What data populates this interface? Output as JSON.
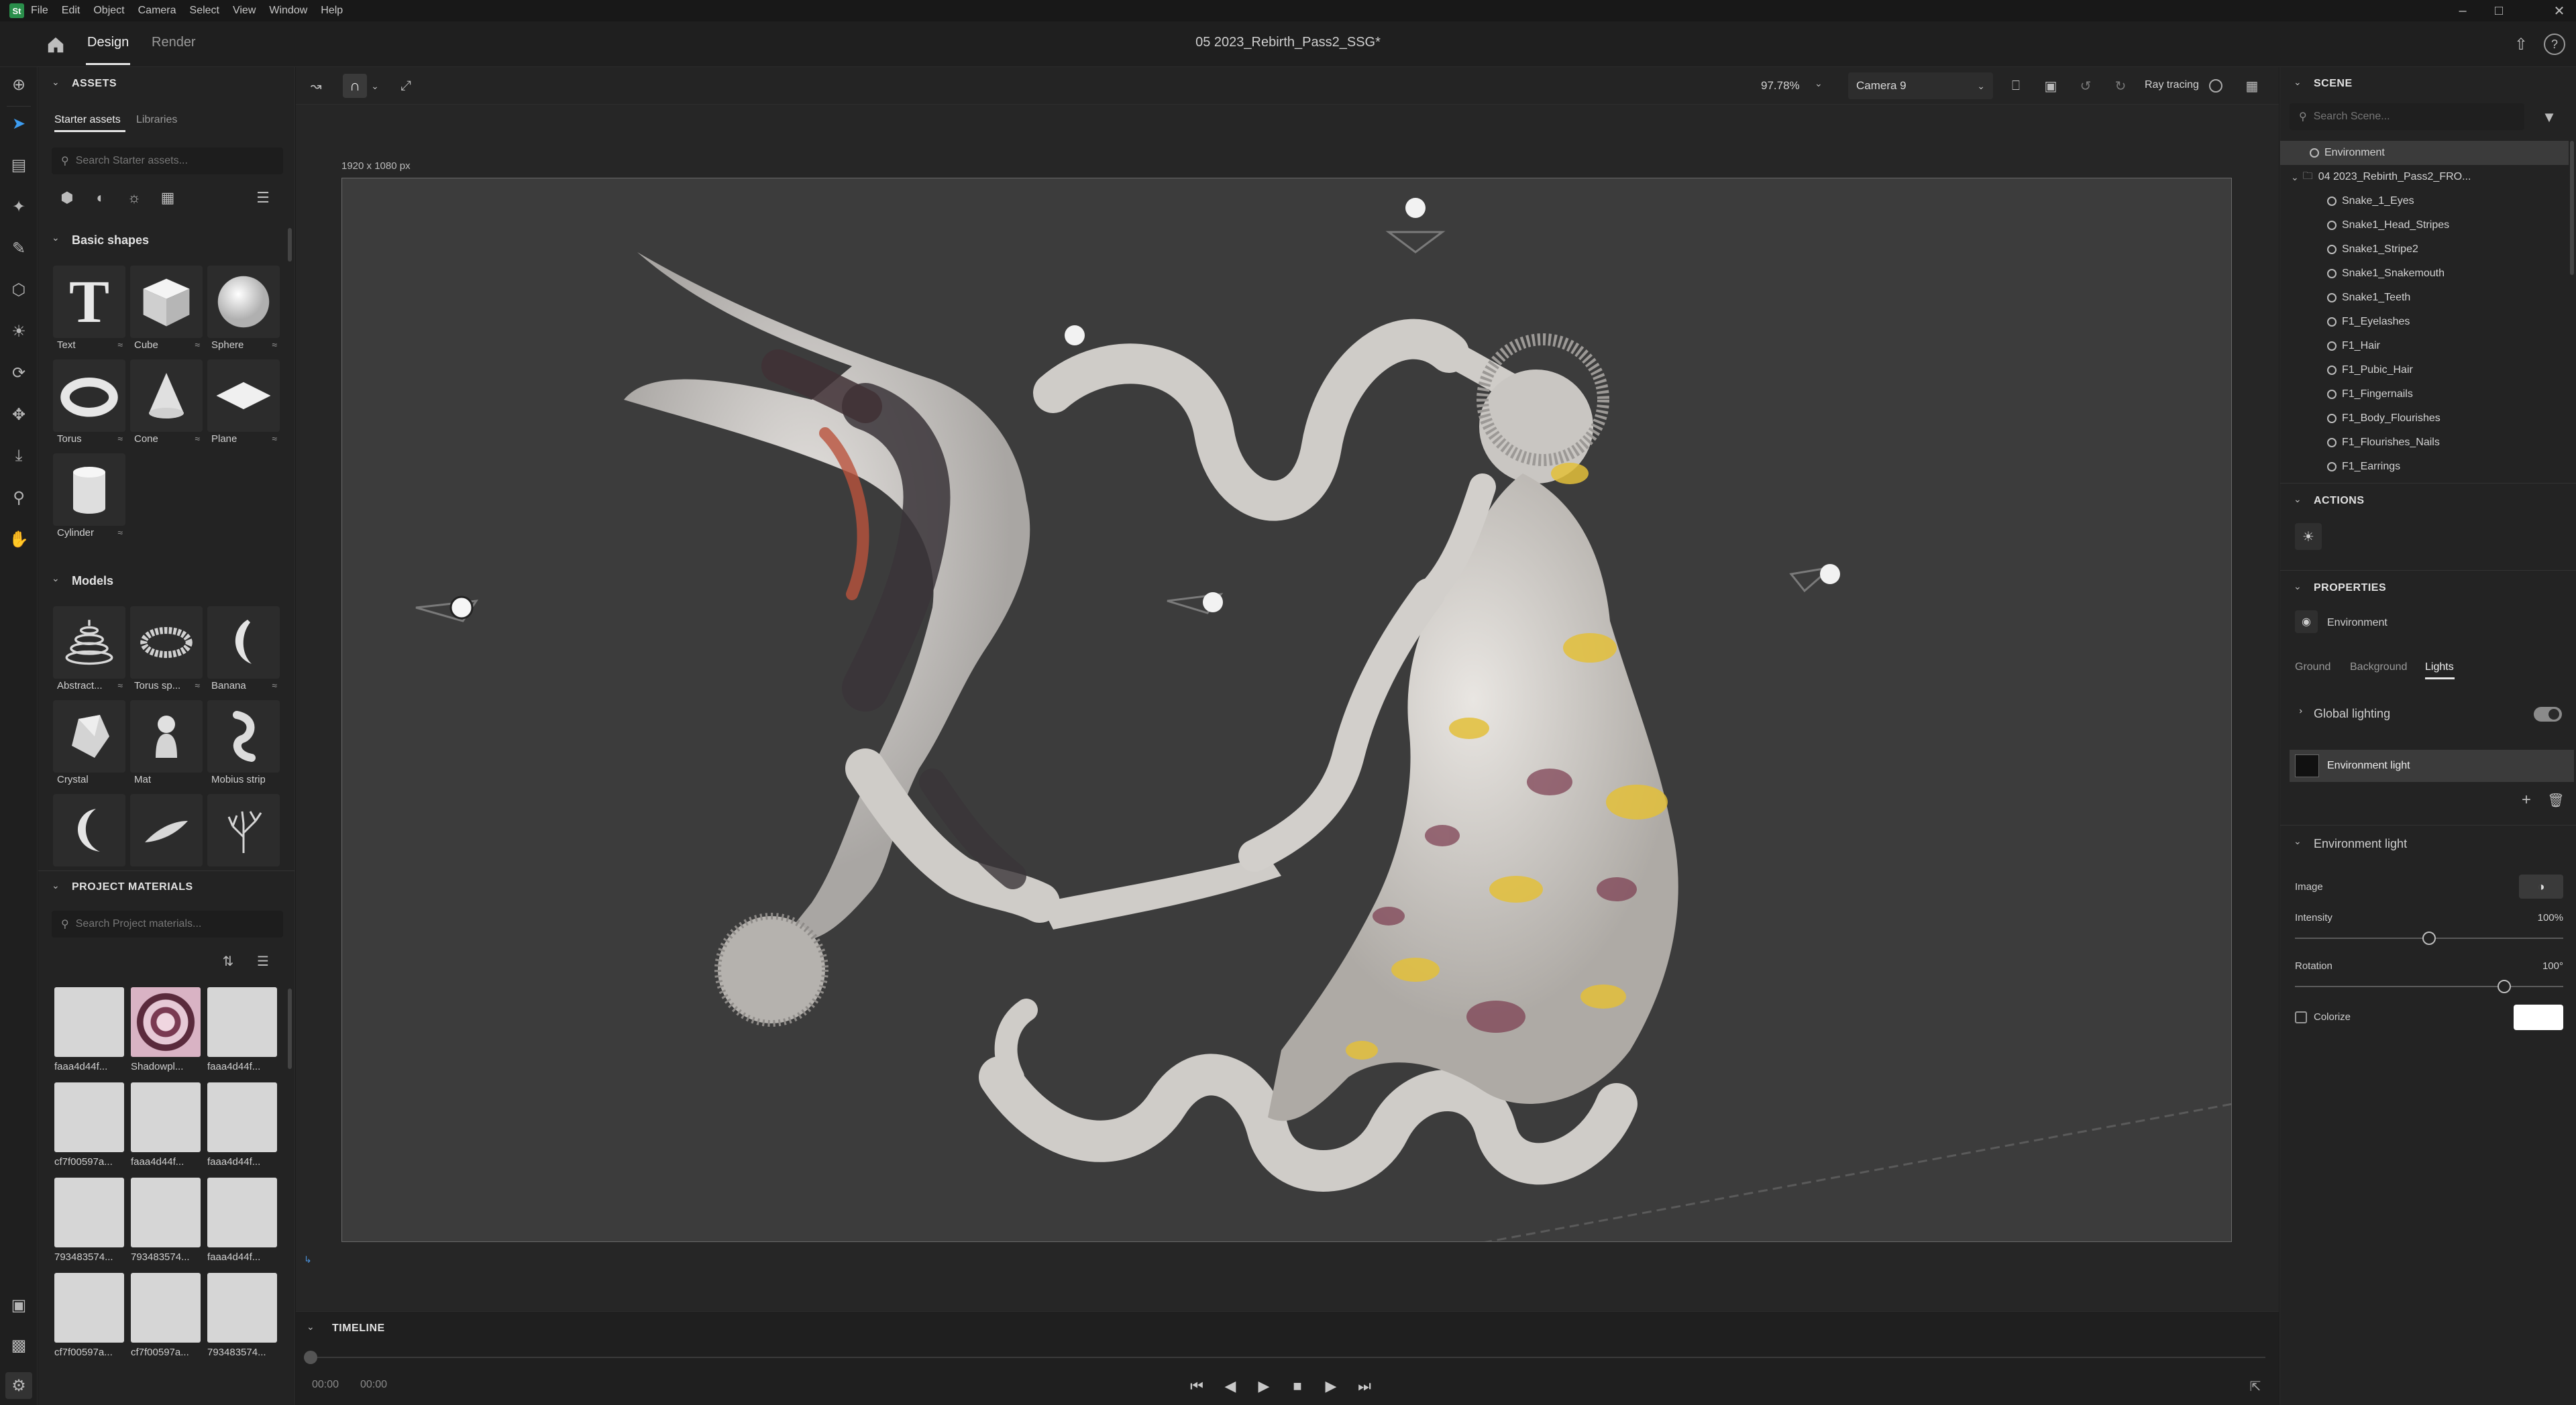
{
  "menu": {
    "app_logo": "St",
    "items": [
      "File",
      "Edit",
      "Object",
      "Camera",
      "Select",
      "View",
      "Window",
      "Help"
    ]
  },
  "header": {
    "tabs": [
      {
        "label": "Design",
        "active": true
      },
      {
        "label": "Render",
        "active": false
      }
    ],
    "doc_title": "05 2023_Rebirth_Pass2_SSG*"
  },
  "assets": {
    "section_title": "ASSETS",
    "subtabs": [
      "Starter assets",
      "Libraries"
    ],
    "search_placeholder": "Search Starter assets...",
    "basic_shapes": {
      "title": "Basic shapes",
      "items": [
        "Text",
        "Cube",
        "Sphere",
        "Torus",
        "Cone",
        "Plane",
        "Cylinder"
      ]
    },
    "models": {
      "title": "Models",
      "items": [
        "Abstract...",
        "Torus sp...",
        "Banana",
        "Crystal",
        "Mat",
        "Mobius strip",
        "",
        "",
        ""
      ]
    }
  },
  "project_materials": {
    "title": "PROJECT MATERIALS",
    "search_placeholder": "Search Project materials...",
    "items": [
      "faaa4d44f...",
      "Shadowpl...",
      "faaa4d44f...",
      "cf7f00597a...",
      "faaa4d44f...",
      "faaa4d44f...",
      "793483574...",
      "793483574...",
      "faaa4d44f...",
      "cf7f00597a...",
      "cf7f00597a...",
      "793483574..."
    ]
  },
  "viewport": {
    "zoom": "97.78%",
    "camera": "Camera 9",
    "ray_tracing": "Ray tracing",
    "canvas_size": "1920 x 1080 px"
  },
  "timeline": {
    "title": "TIMELINE",
    "time_current": "00:00",
    "time_total": "00:00"
  },
  "scene": {
    "title": "SCENE",
    "search_placeholder": "Search Scene...",
    "items": [
      {
        "label": "Environment",
        "level": 0,
        "selected": true
      },
      {
        "label": "04 2023_Rebirth_Pass2_FRO...",
        "level": 0,
        "selected": false
      },
      {
        "label": "Snake_1_Eyes",
        "level": 1,
        "selected": false
      },
      {
        "label": "Snake1_Head_Stripes",
        "level": 1,
        "selected": false
      },
      {
        "label": "Snake1_Stripe2",
        "level": 1,
        "selected": false
      },
      {
        "label": "Snake1_Snakemouth",
        "level": 1,
        "selected": false
      },
      {
        "label": "Snake1_Teeth",
        "level": 1,
        "selected": false
      },
      {
        "label": "F1_Eyelashes",
        "level": 1,
        "selected": false
      },
      {
        "label": "F1_Hair",
        "level": 1,
        "selected": false
      },
      {
        "label": "F1_Pubic_Hair",
        "level": 1,
        "selected": false
      },
      {
        "label": "F1_Fingernails",
        "level": 1,
        "selected": false
      },
      {
        "label": "F1_Body_Flourishes",
        "level": 1,
        "selected": false
      },
      {
        "label": "F1_Flourishes_Nails",
        "level": 1,
        "selected": false
      },
      {
        "label": "F1_Earrings",
        "level": 1,
        "selected": false
      }
    ]
  },
  "actions": {
    "title": "ACTIONS"
  },
  "properties": {
    "title": "PROPERTIES",
    "object": "Environment",
    "tabs": [
      {
        "label": "Ground",
        "active": false
      },
      {
        "label": "Background",
        "active": false
      },
      {
        "label": "Lights",
        "active": true
      }
    ],
    "global_lighting": "Global lighting",
    "env_light_item": "Environment light",
    "env_section": "Environment light",
    "image_label": "Image",
    "intensity_label": "Intensity",
    "intensity_value": "100%",
    "intensity_level": 0.5,
    "rotation_label": "Rotation",
    "rotation_value": "100°",
    "rotation_level": 0.78,
    "colorize_label": "Colorize"
  }
}
